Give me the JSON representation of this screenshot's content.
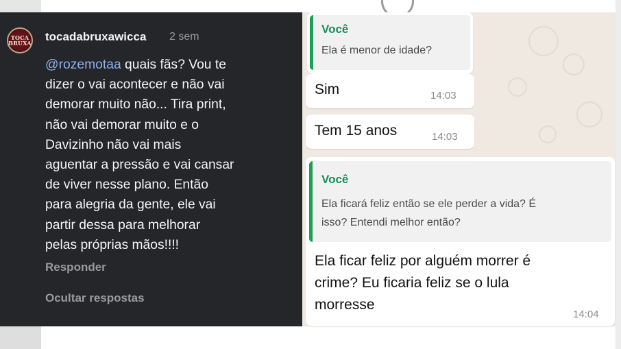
{
  "instagram_comment": {
    "username": "tocadabruxawicca",
    "time_ago": "2 sem",
    "avatar_text": "TOCA BRUXA",
    "mention": "@rozemotaa",
    "body": " quais fãs? Vou te\ndizer o vai acontecer e não vai\ndemorar muito não... Tira print,\nnão vai demorar muito e o\nDavizinho não vai mais\naguentar a pressão e vai cansar\nde viver nesse plano. Então\npara alegria da gente, ele vai\npartir dessa para melhorar\npelas próprias mãos!!!!",
    "reply_label": "Responder",
    "hide_replies_label": "Ocultar respostas"
  },
  "whatsapp_chat": {
    "messages": [
      {
        "quote_author": "Você",
        "quote_text": "Ela é menor de idade?"
      },
      {
        "text": "Sim",
        "time": "14:03"
      },
      {
        "text": "Tem 15 anos",
        "time": "14:03"
      },
      {
        "quote_author": "Você",
        "quote_text": "Ela ficará feliz então se ele perder a vida? É\nisso? Entendi melhor então?",
        "text": "Ela ficar feliz por alguém morrer é\ncrime? Eu ficaria feliz se o lula\nmorresse",
        "time": "14:04"
      }
    ]
  },
  "colors": {
    "instagram_bg": "#25262a",
    "mention": "#8eb0f0",
    "whatsapp_quote_accent": "#1f9e5a",
    "whatsapp_bg": "#efe9e1"
  }
}
